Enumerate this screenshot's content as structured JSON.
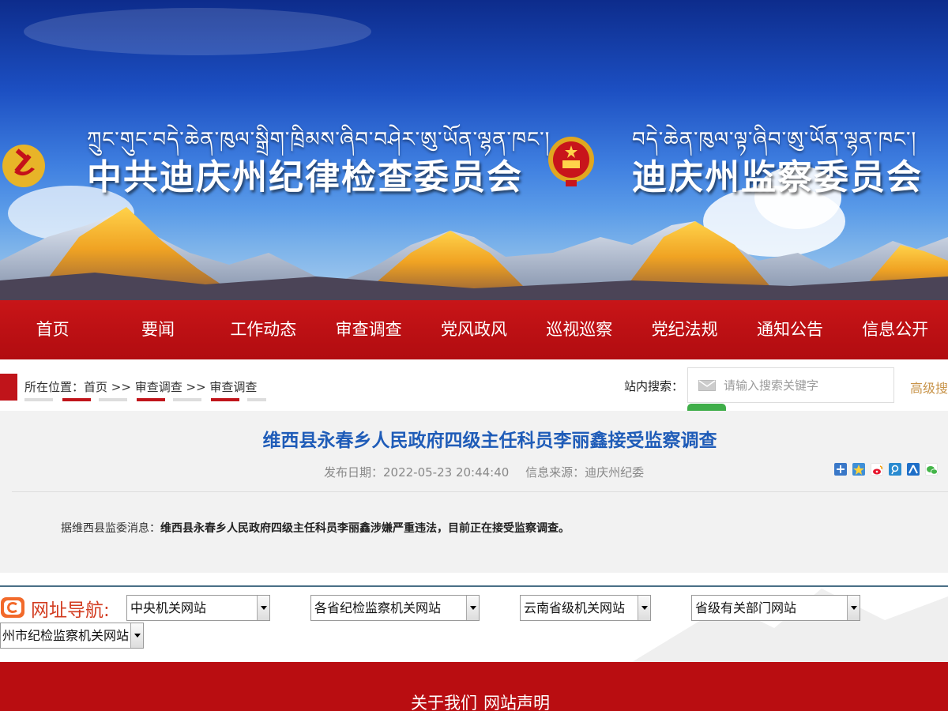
{
  "banner": {
    "tibetan_left": "ཀྲུང་གུང་བདེ་ཆེན་ཁུལ་སྒྲིག་ཁྲིམས་ཞིབ་བཤེར་ཨུ་ཡོན་ལྷན་ཁང་།",
    "title_left": "中共迪庆州纪律检查委员会",
    "tibetan_right": "བདེ་ཆེན་ཁུལ་ལྟ་ཞིབ་ཨུ་ཡོན་ལྷན་ཁང་།",
    "title_right": "迪庆州监察委员会"
  },
  "nav": {
    "items": [
      {
        "label": "首页"
      },
      {
        "label": "要闻"
      },
      {
        "label": "工作动态"
      },
      {
        "label": "审查调查"
      },
      {
        "label": "党风政风"
      },
      {
        "label": "巡视巡察"
      },
      {
        "label": "党纪法规"
      },
      {
        "label": "通知公告"
      },
      {
        "label": "信息公开"
      }
    ]
  },
  "breadcrumb": {
    "prefix": "所在位置：",
    "home": "首页",
    "sep1": " >> ",
    "level1": "审查调查",
    "sep2": " >> ",
    "level2": "审查调查"
  },
  "search": {
    "label": "站内搜索：",
    "placeholder": "请输入搜索关键字",
    "advanced": "高级搜"
  },
  "article": {
    "title": "维西县永春乡人民政府四级主任科员李丽鑫接受监察调查",
    "date": "发布日期：2022-05-23 20:44:40",
    "source": "信息来源：迪庆州纪委",
    "lead": "据维西县监委消息：",
    "body": "维西县永春乡人民政府四级主任科员李丽鑫涉嫌严重违法，目前正在接受监察调查。"
  },
  "share_icons": [
    "plus-icon",
    "qzone-icon",
    "weibo-icon",
    "tencent-weibo-icon",
    "renren-icon",
    "wechat-icon"
  ],
  "link_nav": {
    "label": "网址导航:",
    "selects": [
      {
        "value": "中央机关网站"
      },
      {
        "value": "各省纪检监察机关网站"
      },
      {
        "value": "云南省级机关网站"
      },
      {
        "value": "省级有关部门网站"
      },
      {
        "value": "州市纪检监察机关网站"
      }
    ]
  },
  "footer": {
    "about": "关于我们",
    "statement": "网站声明"
  },
  "colors": {
    "nav_red": "#b90d11",
    "title_blue": "#1f5cb8",
    "advanced_gold": "#c8944a",
    "search_green": "#3fae49"
  }
}
